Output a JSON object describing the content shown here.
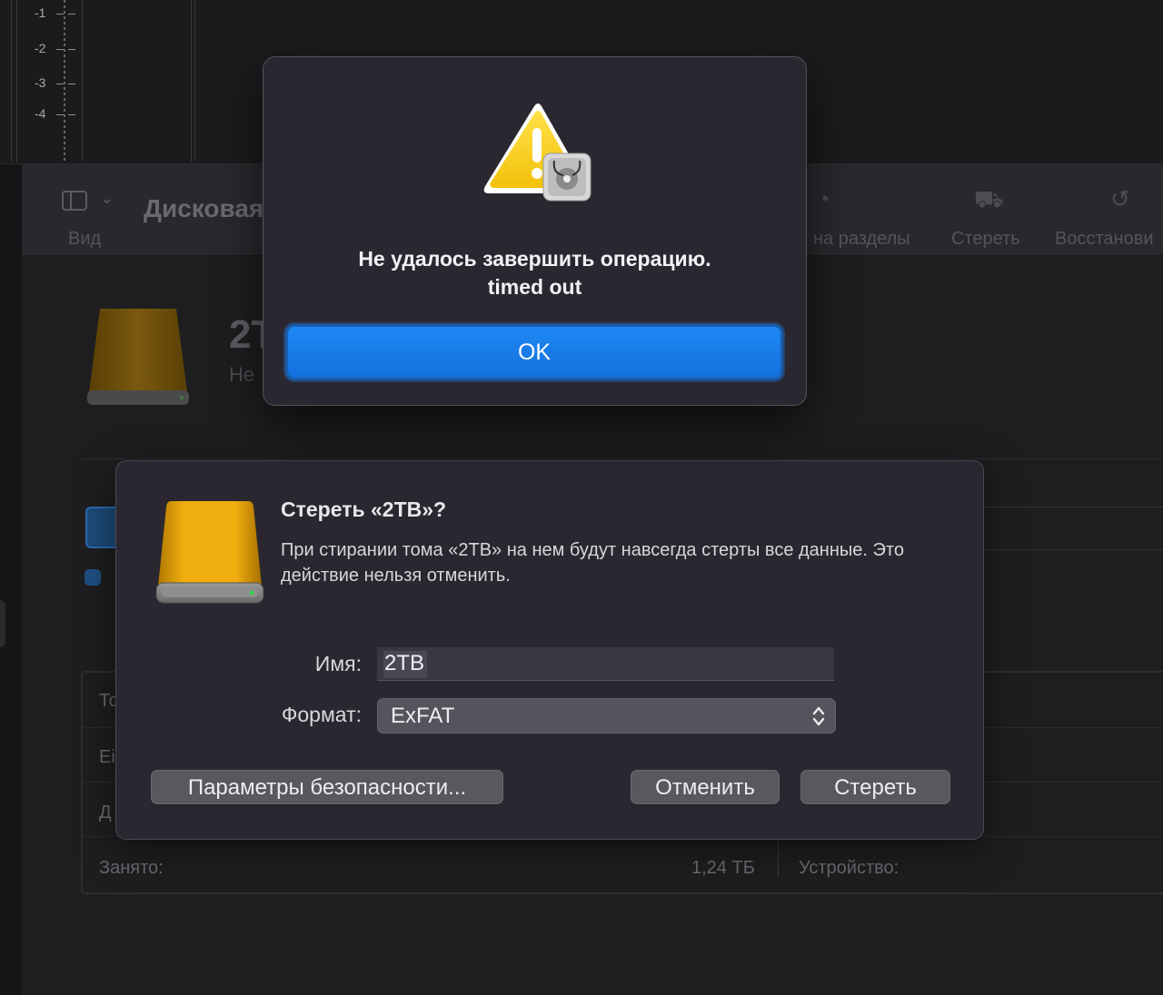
{
  "ruler": {
    "ticks": [
      "-1",
      "-2",
      "-3",
      "-4"
    ]
  },
  "toolbar": {
    "view_label": "Вид",
    "title": "Дисковая",
    "partition_label": "на разделы",
    "erase_label": "Стереть",
    "restore_label": "Восстанови"
  },
  "background_volume": {
    "name": "2T",
    "subtitle": "Не"
  },
  "info_table": {
    "row1_label": "То",
    "row2_label": "Ei",
    "row3_label": "Д",
    "used_label": "Занято:",
    "used_value": "1,24 ТБ",
    "device_label": "Устройство:"
  },
  "erase_sheet": {
    "title": "Стереть «2TB»?",
    "description": "При стирании тома «2TB» на нем будут навсегда стерты все данные. Это действие нельзя отменить.",
    "name_label": "Имя:",
    "name_value": "2TB",
    "format_label": "Формат:",
    "format_value": "ExFAT",
    "security_button": "Параметры безопасности...",
    "cancel_button": "Отменить",
    "erase_button": "Стереть"
  },
  "alert": {
    "title_line1": "Не удалось завершить операцию.",
    "title_line2": "timed out",
    "ok_button": "OK"
  },
  "colors": {
    "accent_blue": "#1a7cef",
    "drive_gold": "#e8a400",
    "sheet_bg": "#2a2730"
  },
  "icons": {
    "alert_icon": "warning-triangle-with-disk-utility-icon",
    "drive_icon": "external-drive-icon"
  }
}
